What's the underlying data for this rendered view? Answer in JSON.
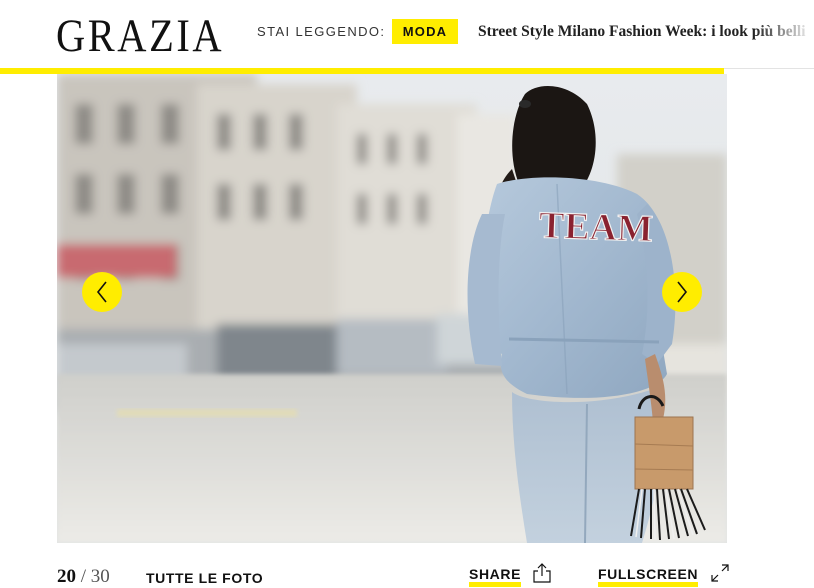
{
  "header": {
    "logo": "GRAZIA",
    "reading_label": "STAI LEGGENDO:",
    "category": "MODA",
    "article_title": "Street Style Milano Fashion Week: i look più belli"
  },
  "reading_progress": 0.89,
  "gallery": {
    "current": "20",
    "separator": "/",
    "total": "30",
    "all_photos_label": "TUTTE LE FOTO",
    "share_label": "SHARE",
    "fullscreen_label": "FULLSCREEN",
    "jacket_text": "TEAM"
  },
  "colors": {
    "accent": "#ffed00",
    "text": "#111111"
  },
  "icons": {
    "prev": "chevron-left-icon",
    "next": "chevron-right-icon",
    "share": "share-icon",
    "fullscreen": "expand-icon"
  }
}
